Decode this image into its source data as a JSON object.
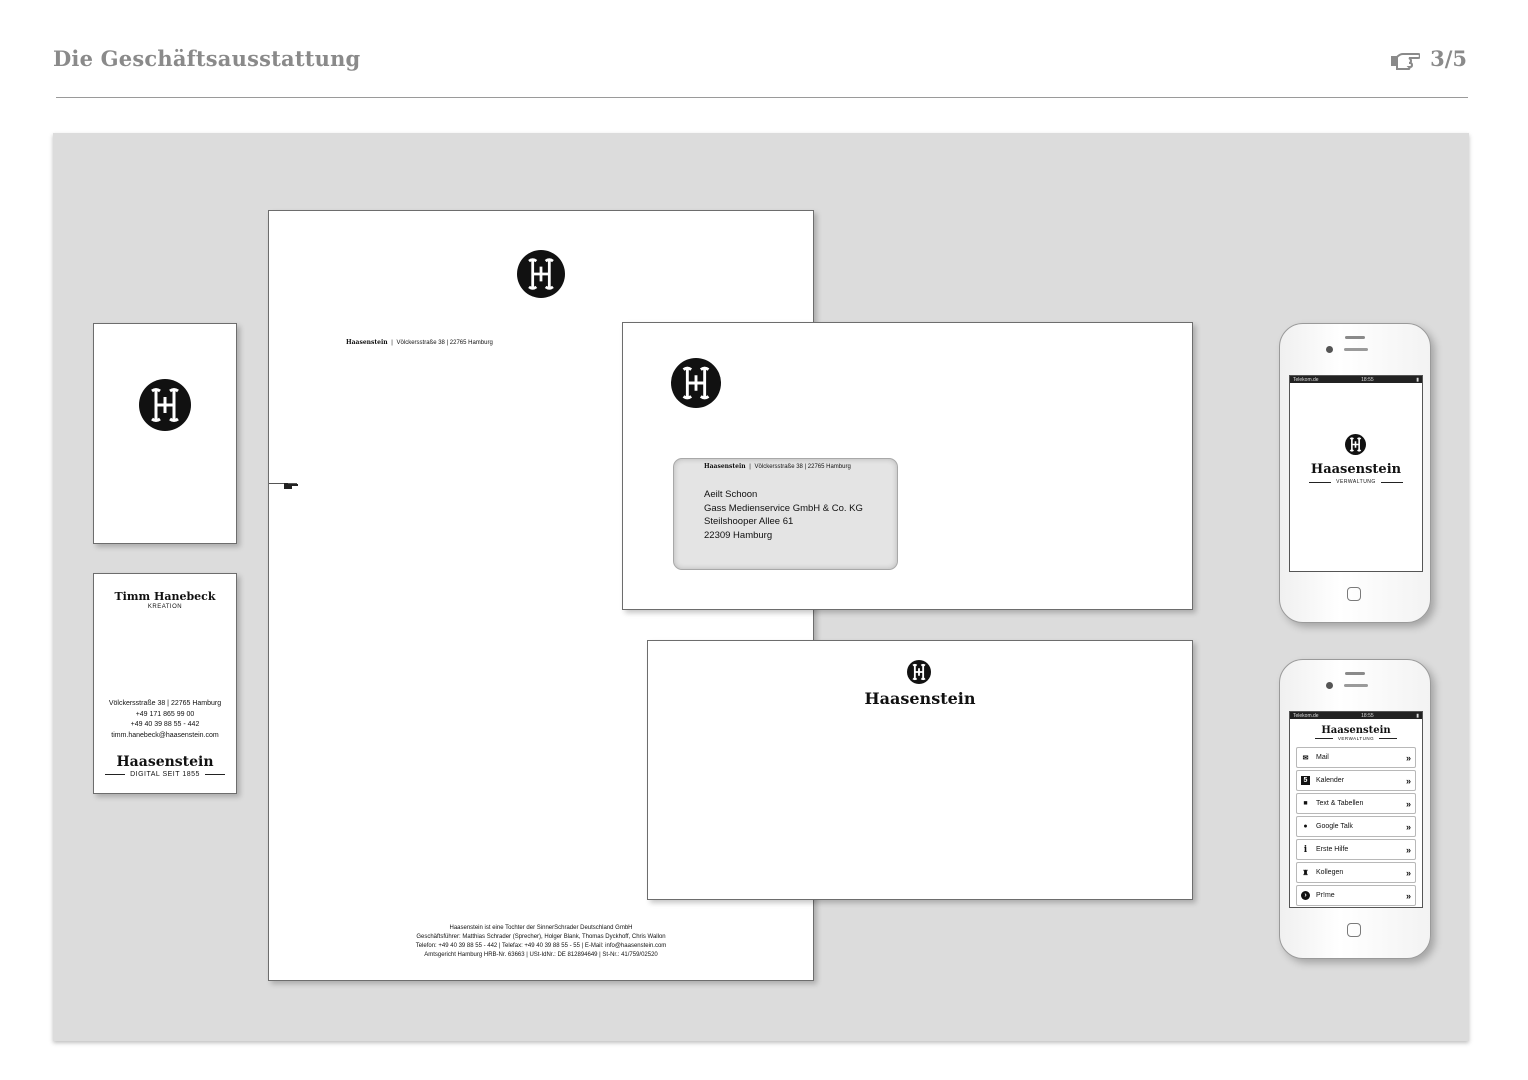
{
  "header": {
    "title": "Die Geschäftsausstattung",
    "counter": "3/5",
    "hand_icon": "pointing-hand-icon"
  },
  "business_card": {
    "name": "Timm Hanebeck",
    "role": "KREATION",
    "address": "Völckersstraße 38 | 22765 Hamburg",
    "phone1": "+49 171 865 99 00",
    "phone2": "+49 40 39 88 55 - 442",
    "email": "timm.hanebeck@haasenstein.com",
    "brand": "Haasenstein",
    "tagline": "DIGITAL SEIT 1855"
  },
  "letterhead": {
    "sender_brand": "Haasenstein",
    "sender_address": "Völckersstraße 38 | 22765 Hamburg",
    "footer": [
      "Haasenstein ist eine Tochter der SinnerSchrader Deutschland GmbH",
      "Geschäftsführer: Matthias Schrader (Sprecher), Holger Blank, Thomas Dyckhoff, Chris Wallon",
      "Telefon: +49 40 39 88 55 - 442 | Telefax: +49 40 39 88 55 - 55 | E-Mail: info@haasenstein.com",
      "Amtsgericht Hamburg HRB-Nr. 63663 | USt-IdNr.: DE 812894649 | St-Nr.: 41/759/02520"
    ]
  },
  "envelope": {
    "sender_brand": "Haasenstein",
    "sender_address": "Völckersstraße 38 | 22765 Hamburg",
    "recipient": [
      "Aeilt Schoon",
      "Gass Medienservice GmbH & Co. KG",
      "Steilshooper Allee 61",
      "22309 Hamburg"
    ]
  },
  "envelope_back": {
    "brand": "Haasenstein"
  },
  "phone1": {
    "carrier": "Telekom.de",
    "time": "18:55",
    "brand": "Haasenstein",
    "subtitle": "VERWALTUNG"
  },
  "phone2": {
    "carrier": "Telekom.de",
    "time": "18:55",
    "brand": "Haasenstein",
    "subtitle": "VERWALTUNG",
    "menu": [
      {
        "label": "Mail",
        "icon": "mail-icon"
      },
      {
        "label": "Kalender",
        "icon": "calendar-icon"
      },
      {
        "label": "Text & Tabellen",
        "icon": "document-icon"
      },
      {
        "label": "Google Talk",
        "icon": "chat-bubble-icon"
      },
      {
        "label": "Erste Hilfe",
        "icon": "info-icon"
      },
      {
        "label": "Kollegen",
        "icon": "people-icon"
      },
      {
        "label": "Pr!me",
        "icon": "prime-icon"
      }
    ],
    "chevron": "»"
  }
}
